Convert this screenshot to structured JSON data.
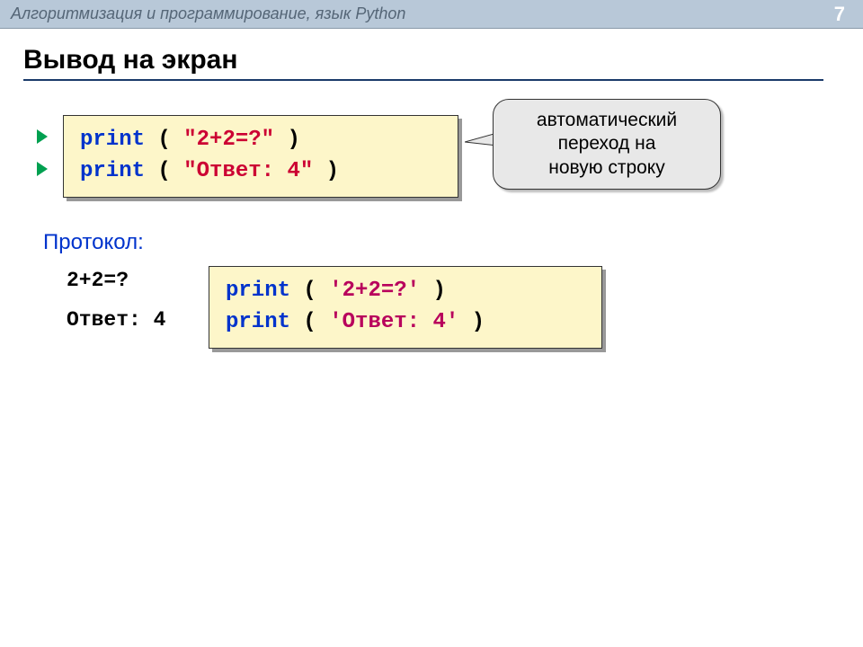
{
  "header": {
    "title": "Алгоритмизация и программирование, язык Python",
    "page": "7"
  },
  "title": "Вывод на экран",
  "callout": {
    "line1": "автоматический",
    "line2": "переход на",
    "line3": "новую строку"
  },
  "code1": {
    "kw": "print",
    "open": " ( ",
    "close": " )",
    "str1": "\"2+2=?\"",
    "str2": "\"Ответ: 4\""
  },
  "protocol": {
    "label": "Протокол:",
    "line1": "2+2=?",
    "line2": "Ответ: 4"
  },
  "code2": {
    "kw": "print",
    "open": " ( ",
    "close": " )",
    "str1": "'2+2=?'",
    "str2": "'Ответ: 4'"
  }
}
